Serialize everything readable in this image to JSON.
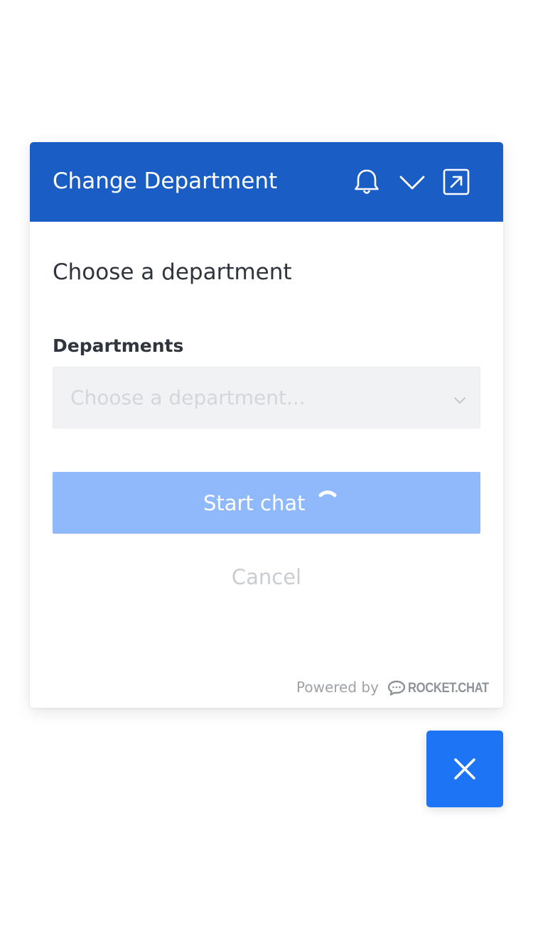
{
  "header": {
    "title": "Change Department",
    "background_color": "#1a5ec5",
    "icons": [
      "bell-icon",
      "chevron-down-icon",
      "popout-icon"
    ]
  },
  "main": {
    "heading": "Choose a department",
    "department_field": {
      "label": "Departments",
      "placeholder": "Choose a department...",
      "value": ""
    },
    "start_button": {
      "label": "Start chat",
      "state": "loading",
      "color": "#8fb9fa"
    },
    "cancel_label": "Cancel"
  },
  "footer": {
    "powered_by": "Powered by",
    "brand": "ROCKET.CHAT"
  },
  "close_button": {
    "icon": "close-icon",
    "color": "#1d74f5"
  }
}
